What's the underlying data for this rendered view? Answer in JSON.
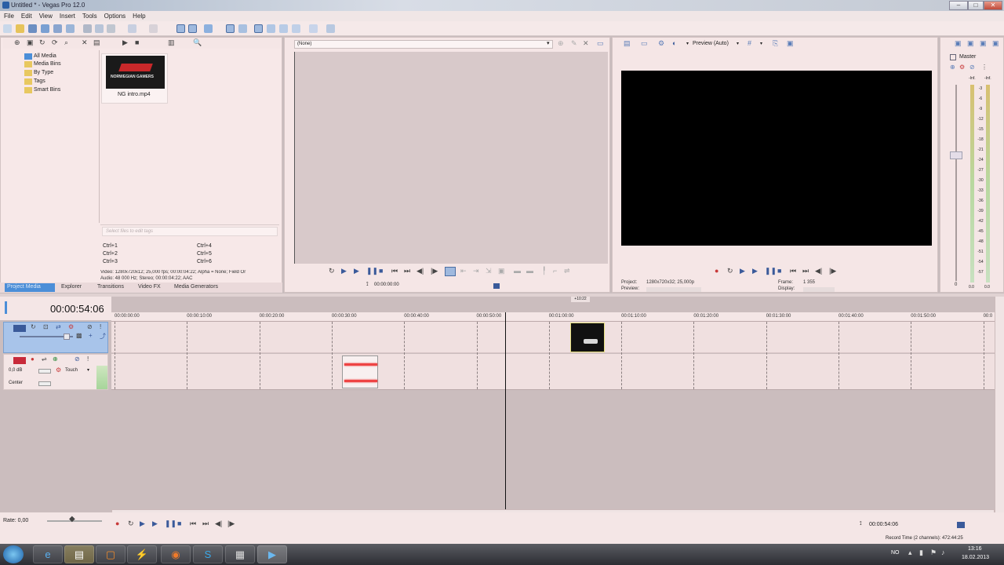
{
  "window": {
    "title": "Untitled * - Vegas Pro 12.0",
    "min": "–",
    "max": "□",
    "close": "✕"
  },
  "menu": [
    "File",
    "Edit",
    "View",
    "Insert",
    "Tools",
    "Options",
    "Help"
  ],
  "media_tree": {
    "root": "All Media",
    "items": [
      "Media Bins",
      "By Type",
      "Tags",
      "Smart Bins"
    ]
  },
  "media_file": {
    "name": "NG intro.mp4",
    "thumb_text": "NORWEGIAN GAMERS"
  },
  "tags": {
    "placeholder": "Select files to edit tags",
    "shortcuts": [
      "Ctrl+1",
      "Ctrl+2",
      "Ctrl+3",
      "Ctrl+4",
      "Ctrl+5",
      "Ctrl+6"
    ]
  },
  "media_info": {
    "line1": "Video: 1280x720x12; 25,000 fps; 00:00:04:22; Alpha = None; Field Or",
    "line2": "Audio: 48 000 Hz; Stereo; 00:00:04:22; AAC"
  },
  "left_tabs": [
    "Project Media",
    "Explorer",
    "Transitions",
    "Video FX",
    "Media Generators"
  ],
  "trimmer": {
    "source": "(None)",
    "timecode": "00:00:00:00"
  },
  "preview": {
    "mode": "Preview (Auto)",
    "project_label": "Project:",
    "project_value": "1280x720x32; 25,000p",
    "preview_label": "Preview:",
    "frame_label": "Frame:",
    "frame_value": "1 355",
    "display_label": "Display:"
  },
  "master": {
    "label": "Master",
    "scale": [
      "3",
      "6",
      "9",
      "12",
      "15",
      "18",
      "21",
      "24",
      "27",
      "30",
      "33",
      "36",
      "39",
      "42",
      "45",
      "48",
      "51",
      "54",
      "57"
    ],
    "inf_left": "-Inf.",
    "inf_right": "-Inf.",
    "left_val": "0",
    "bottom_left": "0.0",
    "bottom_right": "0.0"
  },
  "timeline": {
    "timecode": "00:00:54:06",
    "marker": "+10:22",
    "ruler": [
      "00:00:00:00",
      "00:00:10:00",
      "00:00:20:00",
      "00:00:30:00",
      "00:00:40:00",
      "00:00:50:00",
      "00:01:00:00",
      "00:01:10:00",
      "00:01:20:00",
      "00:01:30:00",
      "00:01:40:00",
      "00:01:50:00",
      "00:0"
    ],
    "audio_track": {
      "volume": "0,0 dB",
      "mode": "Touch",
      "pan": "Center"
    }
  },
  "transport": {
    "rate": "Rate: 0,00",
    "timecode": "00:00:54:06",
    "record_time": "Record Time (2 channels): 472:44:25"
  },
  "taskbar": {
    "lang": "NO",
    "time": "13:16",
    "date": "18.02.2013"
  },
  "colors": {
    "accent": "#4b8ed8",
    "panel": "#f7e8e8",
    "timeline_bg": "#cbbdbe",
    "clip_video": "#111111"
  }
}
